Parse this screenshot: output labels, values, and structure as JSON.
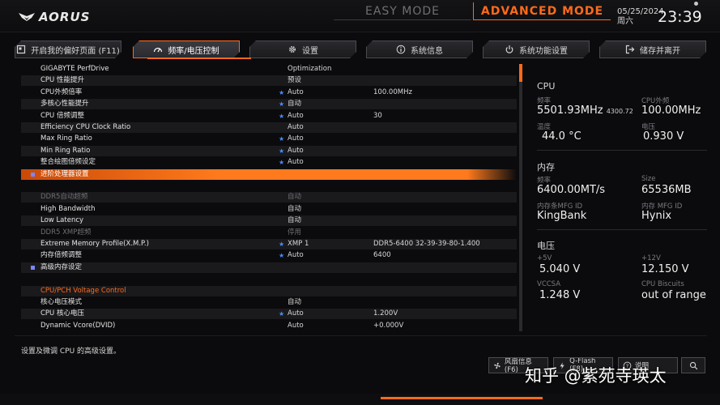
{
  "header": {
    "brand": "AORUS",
    "easy_mode": "EASY MODE",
    "advanced_mode": "ADVANCED MODE",
    "date": "05/25/2024",
    "weekday": "周六",
    "time": "23:39"
  },
  "tabs": [
    {
      "label": "开启我的偏好页面 (F11)",
      "icon": "page-icon"
    },
    {
      "label": "频率/电压控制",
      "icon": "gauge-icon"
    },
    {
      "label": "设置",
      "icon": "gear-icon"
    },
    {
      "label": "系统信息",
      "icon": "info-icon"
    },
    {
      "label": "系统功能设置",
      "icon": "power-icon"
    },
    {
      "label": "储存并离开",
      "icon": "exit-icon"
    }
  ],
  "settings": [
    {
      "name": "GIGABYTE PerfDrive",
      "value": "Optimization",
      "value2": "",
      "star": false,
      "style": "normal"
    },
    {
      "name": "CPU 性能提升",
      "value": "预设",
      "value2": "",
      "star": false,
      "style": "normal"
    },
    {
      "name": "CPU外频倍率",
      "value": "Auto",
      "value2": "100.00MHz",
      "star": true,
      "style": "normal"
    },
    {
      "name": "多核心性能提升",
      "value": "自动",
      "value2": "",
      "star": true,
      "style": "normal"
    },
    {
      "name": "CPU 倍频调整",
      "value": "Auto",
      "value2": "30",
      "star": true,
      "style": "normal"
    },
    {
      "name": "Efficiency CPU Clock Ratio",
      "value": "Auto",
      "value2": "",
      "star": false,
      "style": "normal"
    },
    {
      "name": "Max Ring Ratio",
      "value": "Auto",
      "value2": "",
      "star": true,
      "style": "normal"
    },
    {
      "name": "Min Ring Ratio",
      "value": "Auto",
      "value2": "",
      "star": true,
      "style": "normal"
    },
    {
      "name": "整合绘图倍频设定",
      "value": "Auto",
      "value2": "",
      "star": true,
      "style": "normal"
    },
    {
      "name": "进阶处理器设置",
      "value": "",
      "value2": "",
      "star": false,
      "style": "highlight"
    },
    {
      "name": "",
      "value": "",
      "value2": "",
      "star": false,
      "style": "blank"
    },
    {
      "name": "DDR5自动超频",
      "value": "自动",
      "value2": "",
      "star": false,
      "style": "dim"
    },
    {
      "name": "High Bandwidth",
      "value": "自动",
      "value2": "",
      "star": false,
      "style": "normal"
    },
    {
      "name": "Low Latency",
      "value": "自动",
      "value2": "",
      "star": false,
      "style": "normal"
    },
    {
      "name": "DDR5 XMP超频",
      "value": "停用",
      "value2": "",
      "star": false,
      "style": "dim"
    },
    {
      "name": "Extreme Memory Profile(X.M.P.)",
      "value": "XMP 1",
      "value2": "DDR5-6400 32-39-39-80-1.400",
      "star": true,
      "style": "normal"
    },
    {
      "name": "内存倍频调整",
      "value": "Auto",
      "value2": "6400",
      "star": true,
      "style": "normal"
    },
    {
      "name": "高级内存设定",
      "value": "",
      "value2": "",
      "star": false,
      "style": "bullet"
    },
    {
      "name": "",
      "value": "",
      "value2": "",
      "star": false,
      "style": "blank"
    },
    {
      "name": "CPU/PCH Voltage Control",
      "value": "",
      "value2": "",
      "star": false,
      "style": "section"
    },
    {
      "name": "核心电压模式",
      "value": "自动",
      "value2": "",
      "star": false,
      "style": "normal"
    },
    {
      "name": "CPU 核心电压",
      "value": "Auto",
      "value2": "1.200V",
      "star": true,
      "style": "normal"
    },
    {
      "name": "Dynamic Vcore(DVID)",
      "value": "Auto",
      "value2": "+0.000V",
      "star": false,
      "style": "normal"
    }
  ],
  "info": {
    "cpu": {
      "title": "CPU",
      "freq_label": "频率",
      "freq_value": "5501.93MHz",
      "freq_extra": "4300.72",
      "bclk_label": "CPU外频",
      "bclk_value": "100.00MHz",
      "temp_label": "温度",
      "temp_value": "44.0 °C",
      "volt_label": "电压",
      "volt_value": "0.930 V"
    },
    "memory": {
      "title": "内存",
      "freq_label": "频率",
      "freq_value": "6400.00MT/s",
      "size_label": "Size",
      "size_value": "65536MB",
      "mfg_label": "内存条MFG ID",
      "mfg_value": "KingBank",
      "ic_label": "内存 MFG ID",
      "ic_value": "Hynix"
    },
    "voltage": {
      "title": "电压",
      "p5v_label": "+5V",
      "p5v_value": "5.040 V",
      "p12v_label": "+12V",
      "p12v_value": "12.150 V",
      "vccsa_label": "VCCSA",
      "vccsa_value": "1.248 V",
      "biscuits_label": "CPU Biscuits",
      "biscuits_value": "out of range"
    }
  },
  "footer": {
    "description": "设置及微调 CPU 的高级设置。",
    "buttons": [
      {
        "label": "风扇信息 (F6)",
        "icon": "fan-icon"
      },
      {
        "label": "Q-Flash (F8)",
        "icon": "flash-icon"
      },
      {
        "label": "说明",
        "icon": "help-icon"
      },
      {
        "label": "",
        "icon": "search-icon"
      }
    ],
    "watermark": "知乎 @紫苑寺瑛太"
  },
  "colors": {
    "accent": "#ff6a1a",
    "star": "#4a8cff",
    "bullet": "#7a86ff"
  }
}
